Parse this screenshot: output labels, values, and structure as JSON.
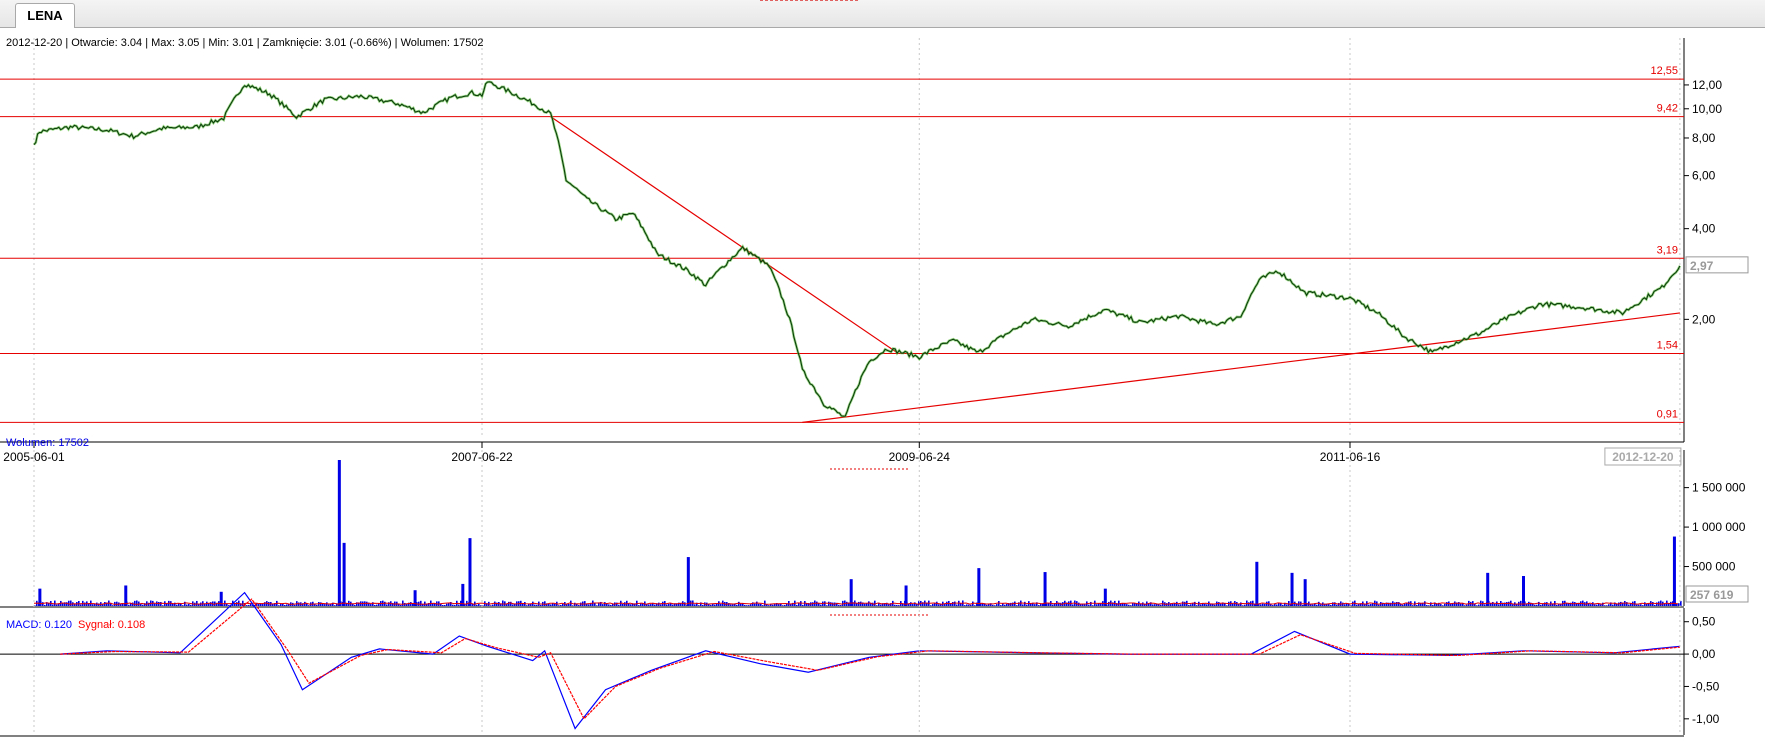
{
  "tab": {
    "label": "LENA"
  },
  "info": "2012-12-20 | Otwarcie: 3.04 | Max: 3.05 | Min: 3.01 | Zamknięcie: 3.01 (-0.66%) | Wolumen: 17502",
  "colors": {
    "price": "#0a3d0a",
    "price_bg": "#5bbf3a",
    "level": "#e60000",
    "volume": "#0000e6",
    "volume_avg": "#e60000",
    "macd": "#0000ff",
    "signal": "#ff0000",
    "grid": "#c8c8c8"
  },
  "chart_data": [
    {
      "type": "line",
      "title": "",
      "scale": "log",
      "ylim": [
        0.82,
        15.2
      ],
      "x_labels": [
        "2005-06-01",
        "2007-06-22",
        "2009-06-24",
        "2011-06-16"
      ],
      "current_date_label": "2012-12-20",
      "y_ticks": [
        2,
        4,
        6,
        8,
        10,
        12
      ],
      "y_tick_labels": [
        "2,00",
        "4,00",
        "6,00",
        "8,00",
        "10,00",
        "12,00"
      ],
      "last_value_label": "2,97",
      "levels": [
        {
          "value": 12.55,
          "label": "12,55"
        },
        {
          "value": 9.42,
          "label": "9,42"
        },
        {
          "value": 3.19,
          "label": "3,19"
        },
        {
          "value": 1.54,
          "label": "1,54"
        },
        {
          "value": 0.91,
          "label": "0,91"
        }
      ],
      "trendlines": [
        {
          "from": [
            "2007-10-15",
            9.42
          ],
          "to": [
            "2009-05-20",
            1.54
          ]
        },
        {
          "from": [
            "2008-12-10",
            0.91
          ],
          "to": [
            "2012-12-20",
            2.1
          ]
        }
      ],
      "series": [
        {
          "points": [
            [
              "2005-06-01",
              7.6
            ],
            [
              "2005-06-10",
              8.4
            ],
            [
              "2005-08-01",
              8.7
            ],
            [
              "2005-10-01",
              8.5
            ],
            [
              "2005-11-15",
              8.1
            ],
            [
              "2006-01-01",
              8.6
            ],
            [
              "2006-03-01",
              8.7
            ],
            [
              "2006-04-15",
              9.3
            ],
            [
              "2006-05-20",
              12.1
            ],
            [
              "2006-07-01",
              11.2
            ],
            [
              "2006-08-15",
              9.4
            ],
            [
              "2006-10-01",
              10.7
            ],
            [
              "2006-12-01",
              11.0
            ],
            [
              "2007-02-01",
              10.4
            ],
            [
              "2007-03-15",
              9.7
            ],
            [
              "2007-05-01",
              10.9
            ],
            [
              "2007-06-05",
              11.3
            ],
            [
              "2007-06-22",
              11.1
            ],
            [
              "2007-07-01",
              12.3
            ],
            [
              "2007-08-15",
              11.2
            ],
            [
              "2007-09-20",
              10.3
            ],
            [
              "2007-10-15",
              9.6
            ],
            [
              "2007-11-10",
              5.8
            ],
            [
              "2007-12-15",
              5.0
            ],
            [
              "2008-02-01",
              4.3
            ],
            [
              "2008-03-01",
              4.5
            ],
            [
              "2008-04-10",
              3.3
            ],
            [
              "2008-06-01",
              2.9
            ],
            [
              "2008-07-01",
              2.6
            ],
            [
              "2008-09-01",
              3.45
            ],
            [
              "2008-10-15",
              3.0
            ],
            [
              "2008-11-15",
              2.1
            ],
            [
              "2008-12-10",
              1.35
            ],
            [
              "2009-01-15",
              1.05
            ],
            [
              "2009-02-20",
              0.94
            ],
            [
              "2009-04-01",
              1.45
            ],
            [
              "2009-05-01",
              1.6
            ],
            [
              "2009-06-24",
              1.5
            ],
            [
              "2009-07-20",
              1.6
            ],
            [
              "2009-08-20",
              1.7
            ],
            [
              "2009-10-01",
              1.55
            ],
            [
              "2009-11-15",
              1.78
            ],
            [
              "2010-01-01",
              2.0
            ],
            [
              "2010-03-01",
              1.9
            ],
            [
              "2010-05-01",
              2.15
            ],
            [
              "2010-07-01",
              1.95
            ],
            [
              "2010-09-01",
              2.05
            ],
            [
              "2010-11-01",
              1.92
            ],
            [
              "2010-12-15",
              2.05
            ],
            [
              "2011-01-15",
              2.7
            ],
            [
              "2011-02-15",
              2.9
            ],
            [
              "2011-04-01",
              2.45
            ],
            [
              "2011-06-16",
              2.35
            ],
            [
              "2011-08-01",
              2.1
            ],
            [
              "2011-09-15",
              1.75
            ],
            [
              "2011-11-01",
              1.55
            ],
            [
              "2011-12-01",
              1.65
            ],
            [
              "2012-01-20",
              1.8
            ],
            [
              "2012-03-01",
              2.0
            ],
            [
              "2012-05-01",
              2.25
            ],
            [
              "2012-07-01",
              2.2
            ],
            [
              "2012-09-15",
              2.1
            ],
            [
              "2012-10-15",
              2.3
            ],
            [
              "2012-11-20",
              2.55
            ],
            [
              "2012-12-20",
              3.01
            ]
          ]
        }
      ]
    },
    {
      "type": "bar",
      "legend": "Wolumen: 17502",
      "ylim": [
        0,
        1850000
      ],
      "y_ticks": [
        500000,
        1000000,
        1500000
      ],
      "y_tick_labels": [
        "500 000",
        "1 000 000",
        "1 500 000"
      ],
      "last_value_label": "257 619",
      "baseline_volume": 28000,
      "spikes": [
        [
          "2005-06-10",
          220000
        ],
        [
          "2005-11-01",
          260000
        ],
        [
          "2006-04-10",
          180000
        ],
        [
          "2006-10-25",
          1850000
        ],
        [
          "2006-11-02",
          800000
        ],
        [
          "2007-03-01",
          200000
        ],
        [
          "2007-05-20",
          280000
        ],
        [
          "2007-06-01",
          860000
        ],
        [
          "2008-06-01",
          620000
        ],
        [
          "2009-03-01",
          340000
        ],
        [
          "2009-06-01",
          260000
        ],
        [
          "2009-10-01",
          480000
        ],
        [
          "2010-01-20",
          430000
        ],
        [
          "2010-05-01",
          220000
        ],
        [
          "2011-01-10",
          560000
        ],
        [
          "2011-03-10",
          420000
        ],
        [
          "2011-04-01",
          340000
        ],
        [
          "2012-02-01",
          420000
        ],
        [
          "2012-04-01",
          380000
        ],
        [
          "2012-12-10",
          880000
        ]
      ]
    },
    {
      "type": "line",
      "legend_macd": "MACD: 0.120",
      "legend_signal": "Sygnał: 0.108",
      "ylim": [
        -1.25,
        0.65
      ],
      "y_ticks": [
        0.5,
        0,
        -0.5,
        -1
      ],
      "y_tick_labels": [
        "0,50",
        "0,00",
        "-0,50",
        "-1,00"
      ],
      "series": [
        {
          "name": "MACD",
          "points": [
            [
              "2005-07-15",
              0.0
            ],
            [
              "2005-10-01",
              0.05
            ],
            [
              "2006-02-01",
              0.02
            ],
            [
              "2006-05-20",
              0.95
            ],
            [
              "2006-07-20",
              0.15
            ],
            [
              "2006-08-25",
              -0.55
            ],
            [
              "2006-11-15",
              -0.05
            ],
            [
              "2007-01-01",
              0.08
            ],
            [
              "2007-04-01",
              0.0
            ],
            [
              "2007-05-15",
              0.28
            ],
            [
              "2007-07-01",
              0.12
            ],
            [
              "2007-09-15",
              -0.1
            ],
            [
              "2007-10-05",
              0.05
            ],
            [
              "2007-11-25",
              -1.15
            ],
            [
              "2008-01-15",
              -0.55
            ],
            [
              "2008-04-01",
              -0.25
            ],
            [
              "2008-07-01",
              0.05
            ],
            [
              "2008-10-01",
              -0.15
            ],
            [
              "2008-12-20",
              -0.28
            ],
            [
              "2009-04-01",
              -0.05
            ],
            [
              "2009-06-24",
              0.05
            ],
            [
              "2010-01-01",
              0.02
            ],
            [
              "2010-06-01",
              0.0
            ],
            [
              "2011-01-01",
              0.0
            ],
            [
              "2011-03-15",
              0.35
            ],
            [
              "2011-06-16",
              0.0
            ],
            [
              "2011-12-01",
              -0.02
            ],
            [
              "2012-04-01",
              0.05
            ],
            [
              "2012-09-01",
              0.02
            ],
            [
              "2012-12-20",
              0.12
            ]
          ]
        },
        {
          "name": "Sygnał",
          "points": [
            [
              "2005-07-15",
              0.0
            ],
            [
              "2005-10-15",
              0.04
            ],
            [
              "2006-02-15",
              0.03
            ],
            [
              "2006-06-01",
              0.85
            ],
            [
              "2006-08-01",
              0.05
            ],
            [
              "2006-09-05",
              -0.45
            ],
            [
              "2006-12-01",
              -0.02
            ],
            [
              "2007-01-15",
              0.07
            ],
            [
              "2007-04-15",
              0.02
            ],
            [
              "2007-05-25",
              0.24
            ],
            [
              "2007-07-15",
              0.1
            ],
            [
              "2007-09-25",
              -0.05
            ],
            [
              "2007-10-15",
              0.02
            ],
            [
              "2007-12-10",
              -1.0
            ],
            [
              "2008-02-01",
              -0.5
            ],
            [
              "2008-04-15",
              -0.22
            ],
            [
              "2008-07-15",
              0.04
            ],
            [
              "2008-10-15",
              -0.12
            ],
            [
              "2009-01-05",
              -0.25
            ],
            [
              "2009-04-15",
              -0.04
            ],
            [
              "2009-07-10",
              0.05
            ],
            [
              "2010-01-15",
              0.02
            ],
            [
              "2010-06-15",
              0.0
            ],
            [
              "2011-01-15",
              0.0
            ],
            [
              "2011-03-25",
              0.3
            ],
            [
              "2011-06-25",
              0.01
            ],
            [
              "2011-12-15",
              -0.02
            ],
            [
              "2012-04-15",
              0.05
            ],
            [
              "2012-09-15",
              0.02
            ],
            [
              "2012-12-20",
              0.108
            ]
          ]
        }
      ]
    }
  ]
}
